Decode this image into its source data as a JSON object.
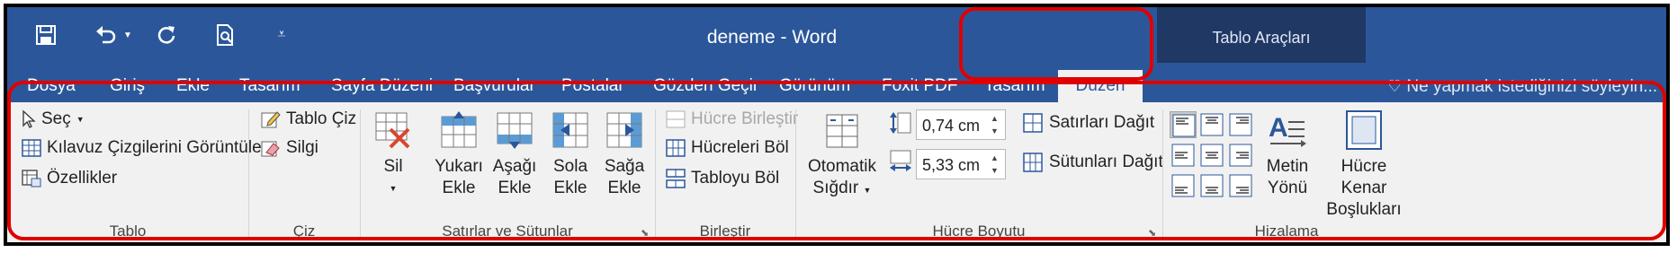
{
  "window": {
    "title": "deneme - Word"
  },
  "contextual": {
    "label": "Tablo Araçları"
  },
  "tabs": [
    {
      "label": "Dosya"
    },
    {
      "label": "Giriş"
    },
    {
      "label": "Ekle"
    },
    {
      "label": "Tasarım"
    },
    {
      "label": "Sayfa Düzeni"
    },
    {
      "label": "Başvurular"
    },
    {
      "label": "Postalar"
    },
    {
      "label": "Gözden Geçir"
    },
    {
      "label": "Görünüm"
    },
    {
      "label": "Foxit PDF"
    },
    {
      "label": "Tasarım"
    },
    {
      "label": "Düzen"
    }
  ],
  "active_tab": "Düzen",
  "tell_me": {
    "text": "Ne yapmak istediğinizi söyleyin..."
  },
  "groups": {
    "tablo": {
      "label": "Tablo",
      "sec": "Seç",
      "kilavuz": "Kılavuz Çizgilerini Görüntüle",
      "ozellikler": "Özellikler"
    },
    "ciz": {
      "label": "Çiz",
      "tablo_ciz": "Tablo Çiz",
      "silgi": "Silgi"
    },
    "satirlar": {
      "label": "Satırlar ve Sütunlar",
      "sil": "Sil",
      "yukari_1": "Yukarı",
      "yukari_2": "Ekle",
      "asagi_1": "Aşağı",
      "asagi_2": "Ekle",
      "sola_1": "Sola",
      "sola_2": "Ekle",
      "saga_1": "Sağa",
      "saga_2": "Ekle"
    },
    "birlestir": {
      "label": "Birleştir",
      "hucre_birlestir": "Hücre Birleştir",
      "hucreleri_bol": "Hücreleri Böl",
      "tabloyu_bol": "Tabloyu Böl"
    },
    "hucre_boyutu": {
      "label": "Hücre Boyutu",
      "otomatik_1": "Otomatik",
      "otomatik_2": "Sığdır",
      "height_value": "0,74 cm",
      "width_value": "5,33 cm",
      "satirlari_dagit": "Satırları Dağıt",
      "sutunlari_dagit": "Sütunları Dağıt"
    },
    "hizalama": {
      "label": "Hizalama",
      "metin_1": "Metin",
      "metin_2": "Yönü",
      "kenar_1": "Hücre Kenar",
      "kenar_2": "Boşlukları"
    }
  },
  "colors": {
    "word_blue": "#2b579a",
    "tools_dark": "#1f3864",
    "ribbon": "#f1f1f1",
    "highlight": "#e00000"
  }
}
